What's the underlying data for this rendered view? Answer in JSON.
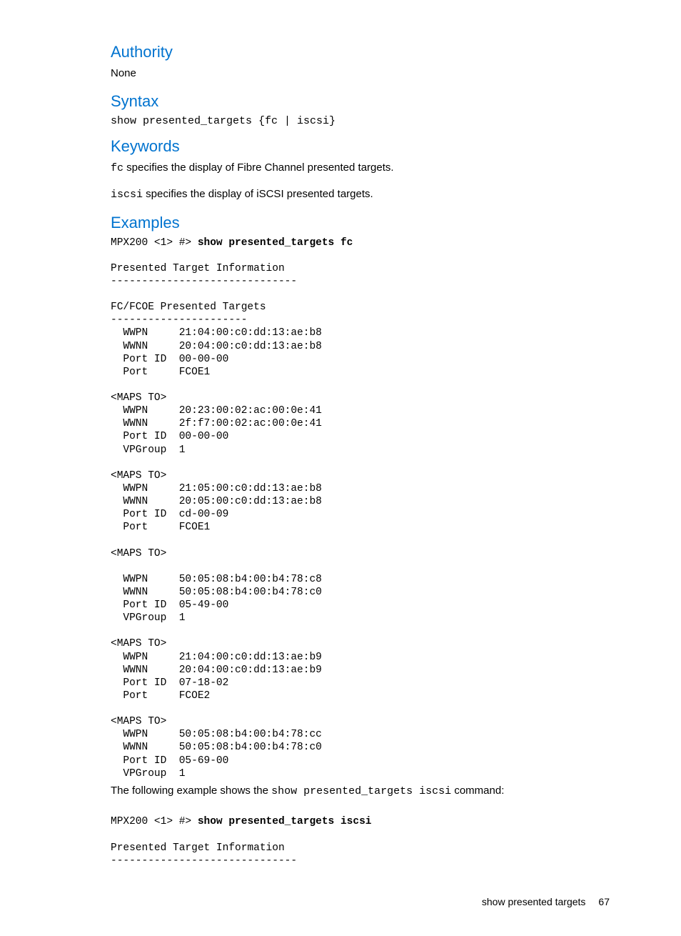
{
  "authority": {
    "heading": "Authority",
    "text": "None"
  },
  "syntax": {
    "heading": "Syntax",
    "line": "show presented_targets {fc | iscsi}"
  },
  "keywords": {
    "heading": "Keywords",
    "fc_mono": "fc",
    "fc_rest": " specifies the display of Fibre Channel presented targets.",
    "iscsi_mono": "iscsi",
    "iscsi_rest": " specifies the display of iSCSI presented targets."
  },
  "examples": {
    "heading": "Examples",
    "prompt1": "MPX200 <1> #> ",
    "cmd1": "show presented_targets fc",
    "block1": "Presented Target Information\n------------------------------\n\nFC/FCOE Presented Targets\n----------------------\n  WWPN     21:04:00:c0:dd:13:ae:b8\n  WWNN     20:04:00:c0:dd:13:ae:b8\n  Port ID  00-00-00\n  Port     FCOE1\n\n<MAPS TO>\n  WWPN     20:23:00:02:ac:00:0e:41\n  WWNN     2f:f7:00:02:ac:00:0e:41\n  Port ID  00-00-00\n  VPGroup  1\n\n<MAPS TO>\n  WWPN     21:05:00:c0:dd:13:ae:b8\n  WWNN     20:05:00:c0:dd:13:ae:b8\n  Port ID  cd-00-09\n  Port     FCOE1\n\n<MAPS TO>\n\n  WWPN     50:05:08:b4:00:b4:78:c8\n  WWNN     50:05:08:b4:00:b4:78:c0\n  Port ID  05-49-00\n  VPGroup  1\n\n<MAPS TO>\n  WWPN     21:04:00:c0:dd:13:ae:b9\n  WWNN     20:04:00:c0:dd:13:ae:b9\n  Port ID  07-18-02\n  Port     FCOE2\n\n<MAPS TO>\n  WWPN     50:05:08:b4:00:b4:78:cc\n  WWNN     50:05:08:b4:00:b4:78:c0\n  Port ID  05-69-00\n  VPGroup  1",
    "mid_text_pre": "The following example shows the ",
    "mid_text_mono": "show presented_targets iscsi",
    "mid_text_post": " command:",
    "prompt2": "MPX200 <1> #> ",
    "cmd2": "show presented_targets iscsi",
    "block2": "Presented Target Information\n------------------------------"
  },
  "footer": {
    "label": "show presented targets",
    "page": "67"
  }
}
